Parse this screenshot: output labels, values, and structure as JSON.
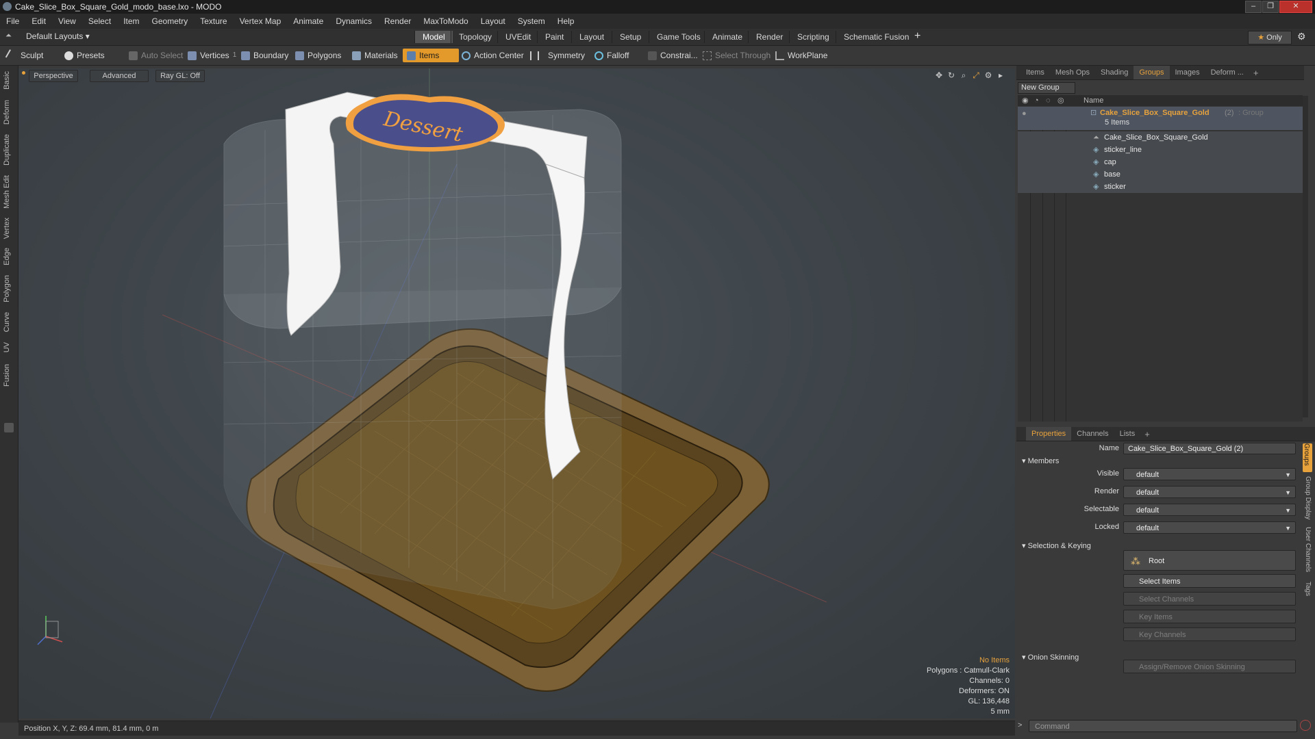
{
  "window": {
    "title": "Cake_Slice_Box_Square_Gold_modo_base.lxo - MODO",
    "controls": [
      "–",
      "❐",
      "✕"
    ]
  },
  "menu": [
    "File",
    "Edit",
    "View",
    "Select",
    "Item",
    "Geometry",
    "Texture",
    "Vertex Map",
    "Animate",
    "Dynamics",
    "Render",
    "MaxToModo",
    "Layout",
    "System",
    "Help"
  ],
  "layout_bar": {
    "layouts_label": "Default Layouts",
    "tabs": [
      "Model",
      "Topology",
      "UVEdit",
      "Paint",
      "Layout",
      "Setup",
      "Game Tools",
      "Animate",
      "Render",
      "Scripting",
      "Schematic Fusion"
    ],
    "active_tab": "Model",
    "add": "+",
    "only_label": "Only"
  },
  "toolbar": {
    "sculpt": "Sculpt",
    "presets": "Presets",
    "auto_select": "Auto Select",
    "vertices": "Vertices",
    "vertices_count": "1",
    "boundary": "Boundary",
    "polygons": "Polygons",
    "materials": "Materials",
    "items": "Items",
    "action_center": "Action Center",
    "symmetry": "Symmetry",
    "falloff": "Falloff",
    "constraints": "Constrai...",
    "select_through": "Select Through",
    "workplane": "WorkPlane"
  },
  "left_tabs": [
    "Basic",
    "Deform",
    "Duplicate",
    "Mesh Edit",
    "Vertex",
    "Edge",
    "Polygon",
    "Curve",
    "UV",
    "Fusion"
  ],
  "viewport": {
    "view": "Perspective",
    "shading": "Advanced",
    "raygl": "Ray GL: Off",
    "sticker_text": "Dessert",
    "stats": {
      "no_items": "No Items",
      "polygons": "Polygons : Catmull-Clark",
      "channels": "Channels: 0",
      "deformers": "Deformers: ON",
      "gl": "GL: 136,448",
      "scale": "5 mm"
    }
  },
  "status": {
    "position": "Position X, Y, Z:  69.4 mm, 81.4 mm, 0 m"
  },
  "items_panel": {
    "tabs": [
      "Items",
      "Mesh Ops",
      "Shading",
      "Groups",
      "Images",
      "Deform ..."
    ],
    "active_tab": "Groups",
    "new_group": "New Group",
    "col_name": "Name",
    "group": {
      "name": "Cake_Slice_Box_Square_Gold",
      "count": "(2)",
      "type": ": Group",
      "items_label": "5 Items"
    },
    "children": [
      "Cake_Slice_Box_Square_Gold",
      "sticker_line",
      "cap",
      "base",
      "sticker"
    ]
  },
  "properties": {
    "tabs": [
      "Properties",
      "Channels",
      "Lists"
    ],
    "active_tab": "Properties",
    "name_label": "Name",
    "name_value": "Cake_Slice_Box_Square_Gold (2)",
    "members_section": "Members",
    "members": [
      {
        "label": "Visible",
        "value": "default"
      },
      {
        "label": "Render",
        "value": "default"
      },
      {
        "label": "Selectable",
        "value": "default"
      },
      {
        "label": "Locked",
        "value": "default"
      }
    ],
    "selection_section": "Selection & Keying",
    "root_label": "Root",
    "select_items": "Select Items",
    "select_channels": "Select Channels",
    "key_items": "Key Items",
    "key_channels": "Key Channels",
    "onion_section": "Onion Skinning",
    "onion_button": "Assign/Remove Onion Skinning",
    "side_tabs": [
      "Groups",
      "Group Display",
      "User Channels",
      "Tags"
    ]
  },
  "command": {
    "placeholder": "Command"
  },
  "colors": {
    "accent": "#e8a23c",
    "base_gold": "#8a6a3a",
    "sticker_blue": "#4a4f8c",
    "sticker_rim": "#f0a040"
  }
}
